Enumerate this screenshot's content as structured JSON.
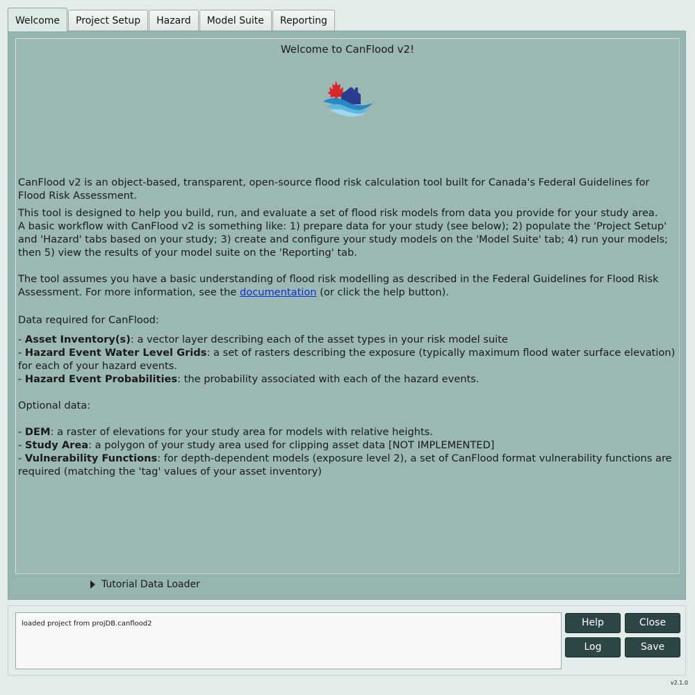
{
  "tabs": [
    {
      "label": "Welcome"
    },
    {
      "label": "Project Setup"
    },
    {
      "label": "Hazard"
    },
    {
      "label": "Model Suite"
    },
    {
      "label": "Reporting"
    }
  ],
  "welcome": {
    "title": "Welcome to CanFlood v2!",
    "intro": "CanFlood v2 is an object-based, transparent, open-source flood risk calculation tool built for Canada's Federal Guidelines for Flood Risk Assessment.",
    "para2_line1": "This tool is designed to help you build, run, and evaluate a set of flood risk models from data you provide for your study area.",
    "para2_line2": "A basic workflow with CanFlood v2 is something like: 1) prepare data for your study (see below); 2) populate the 'Project Setup' and 'Hazard' tabs based on your study; 3) create and configure your study models on the 'Model Suite' tab; 4) run your models; then 5) view the results of your model suite on the 'Reporting' tab.",
    "para3_before": "The tool assumes you have a basic understanding of flood risk modelling as described in the Federal Guidelines for Flood Risk Assessment. For more information, see the ",
    "para3_link": "documentation",
    "para3_after": " (or click the help button).",
    "required_heading": "Data required for CanFlood:",
    "required": [
      {
        "name": "Asset Inventory(s)",
        "desc": ": a vector layer describing each of the asset types in your risk model suite"
      },
      {
        "name": "Hazard Event Water Level Grids",
        "desc": ": a set of rasters describing the exposure (typically maximum flood water surface elevation) for each of your hazard events."
      },
      {
        "name": "Hazard Event Probabilities",
        "desc": ": the probability associated with each of the hazard events."
      }
    ],
    "optional_heading": "Optional data:",
    "optional": [
      {
        "name": "DEM",
        "desc": ": a raster of elevations for your study area for models with relative heights."
      },
      {
        "name": "Study Area",
        "desc": ": a polygon of your study area used for clipping asset data [NOT IMPLEMENTED]"
      },
      {
        "name": "Vulnerability Functions",
        "desc": ": for depth-dependent models (exposure level 2), a set of CanFlood format vulnerability functions are required (matching the 'tag' values of your asset inventory)"
      }
    ],
    "bullet_prefix": "- "
  },
  "tutorial_loader": {
    "label": "Tutorial Data Loader"
  },
  "log": {
    "text": "loaded project from projDB.canflood2"
  },
  "buttons": {
    "help": "Help",
    "close": "Close",
    "log": "Log",
    "save": "Save"
  },
  "version": "v2.1.0",
  "colors": {
    "accent_dark": "#2d4545",
    "panel_bg": "#9bb8b3",
    "link": "#0b2fd6"
  }
}
